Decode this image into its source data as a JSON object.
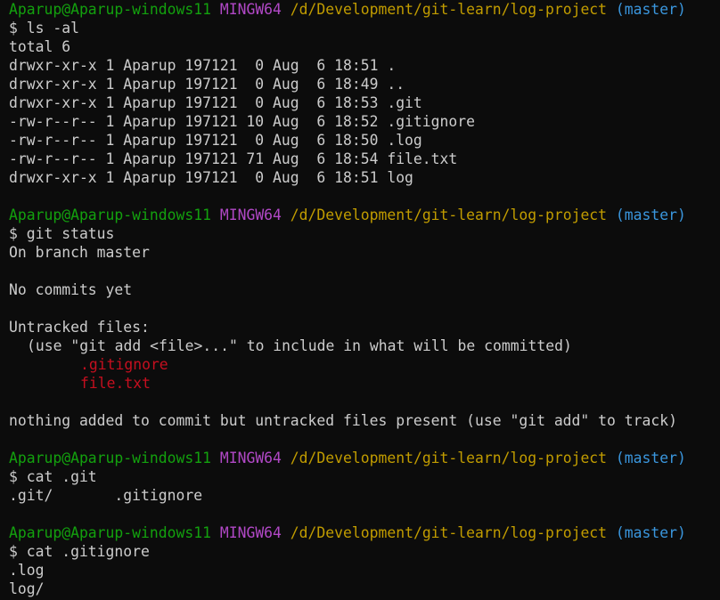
{
  "prompt": {
    "user": "Aparup@Aparup-windows11",
    "system": "MINGW64",
    "path": "/d/Development/git-learn/log-project",
    "branch": "(master)"
  },
  "block1": {
    "command": "$ ls -al",
    "total": "total 6",
    "rows": [
      "drwxr-xr-x 1 Aparup 197121  0 Aug  6 18:51 .",
      "drwxr-xr-x 1 Aparup 197121  0 Aug  6 18:49 ..",
      "drwxr-xr-x 1 Aparup 197121  0 Aug  6 18:53 .git",
      "-rw-r--r-- 1 Aparup 197121 10 Aug  6 18:52 .gitignore",
      "-rw-r--r-- 1 Aparup 197121  0 Aug  6 18:50 .log",
      "-rw-r--r-- 1 Aparup 197121 71 Aug  6 18:54 file.txt",
      "drwxr-xr-x 1 Aparup 197121  0 Aug  6 18:51 log"
    ]
  },
  "block2": {
    "command": "$ git status",
    "branch_line": "On branch master",
    "no_commits": "No commits yet",
    "untracked_header": "Untracked files:",
    "hint": "(use \"git add <file>...\" to include in what will be committed)",
    "untracked": [
      ".gitignore",
      "file.txt"
    ],
    "summary": "nothing added to commit but untracked files present (use \"git add\" to track)"
  },
  "block3": {
    "command": "$ cat .git",
    "output": ".git/       .gitignore"
  },
  "block4": {
    "command": "$ cat .gitignore",
    "output": [
      ".log",
      "log/"
    ]
  },
  "colors": {
    "background": "#0c0c0c",
    "text": "#cccccc",
    "user": "#13a10e",
    "system": "#b148c6",
    "path": "#c19c00",
    "branch": "#3a96dd",
    "untracked": "#c50f1f"
  }
}
